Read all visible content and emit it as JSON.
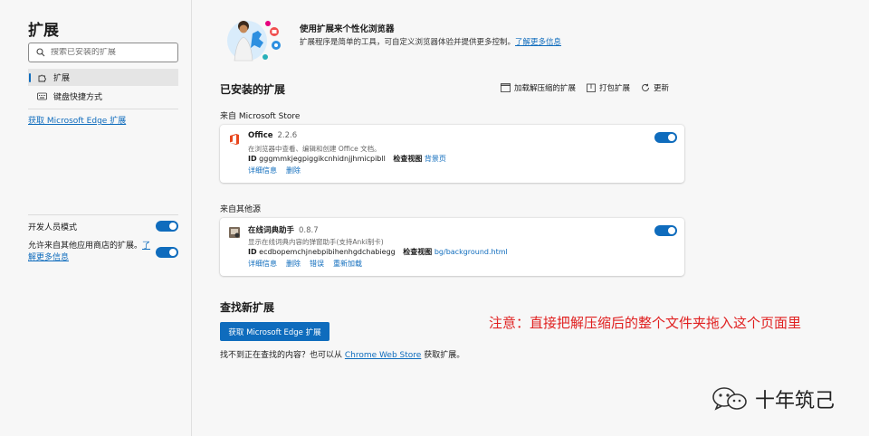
{
  "sidebar": {
    "title": "扩展",
    "search_placeholder": "搜索已安装的扩展",
    "nav": [
      {
        "label": "扩展",
        "icon": "extensions-icon"
      },
      {
        "label": "键盘快捷方式",
        "icon": "keyboard-icon"
      }
    ],
    "get_extensions_link": "获取 Microsoft Edge 扩展",
    "dev_mode_label": "开发人员模式",
    "dev_mode_on": true,
    "allow_other_stores_text": "允许来自其他应用商店的扩展。",
    "allow_other_stores_link": "了解更多信息",
    "allow_other_stores_on": true
  },
  "banner": {
    "title": "使用扩展来个性化浏览器",
    "desc": "扩展程序是简单的工具，可自定义浏览器体验并提供更多控制。",
    "learn_more": "了解更多信息"
  },
  "installed": {
    "title": "已安装的扩展",
    "toolbar": {
      "load_unpacked": "加载解压缩的扩展",
      "pack": "打包扩展",
      "refresh": "更新"
    }
  },
  "sections": {
    "from_store": "来自 Microsoft Store",
    "from_other": "来自其他源"
  },
  "extensions": [
    {
      "name": "Office",
      "version": "2.2.6",
      "desc": "在浏览器中查看、编辑和创建 Office 文档。",
      "id_label": "ID",
      "id": "gggmmkjegpiggikcnhidnjjhmicpibll",
      "inspect_label": "检查视图",
      "inspect_link": "背景页",
      "actions": [
        "详细信息",
        "删除"
      ],
      "enabled": true
    },
    {
      "name": "在线词典助手",
      "version": "0.8.7",
      "desc": "显示在线词典内容的弹窗助手(支持Anki制卡)",
      "id_label": "ID",
      "id": "ecdbopemchjnebpibihenhgdchabiegg",
      "inspect_label": "检查视图",
      "inspect_link": "bg/background.html",
      "actions": [
        "详细信息",
        "删除",
        "错误",
        "重新加载"
      ],
      "enabled": true
    }
  ],
  "find": {
    "title": "查找新扩展",
    "button": "获取 Microsoft Edge 扩展",
    "note_pre": "找不到正在查找的内容？也可以从",
    "note_link": "Chrome Web Store",
    "note_post": "获取扩展。"
  },
  "annotation": "注意：直接把解压缩后的整个文件夹拖入这个页面里",
  "watermark": "十年筑己",
  "colors": {
    "accent": "#0f6cbd",
    "annotation": "#e02020"
  }
}
